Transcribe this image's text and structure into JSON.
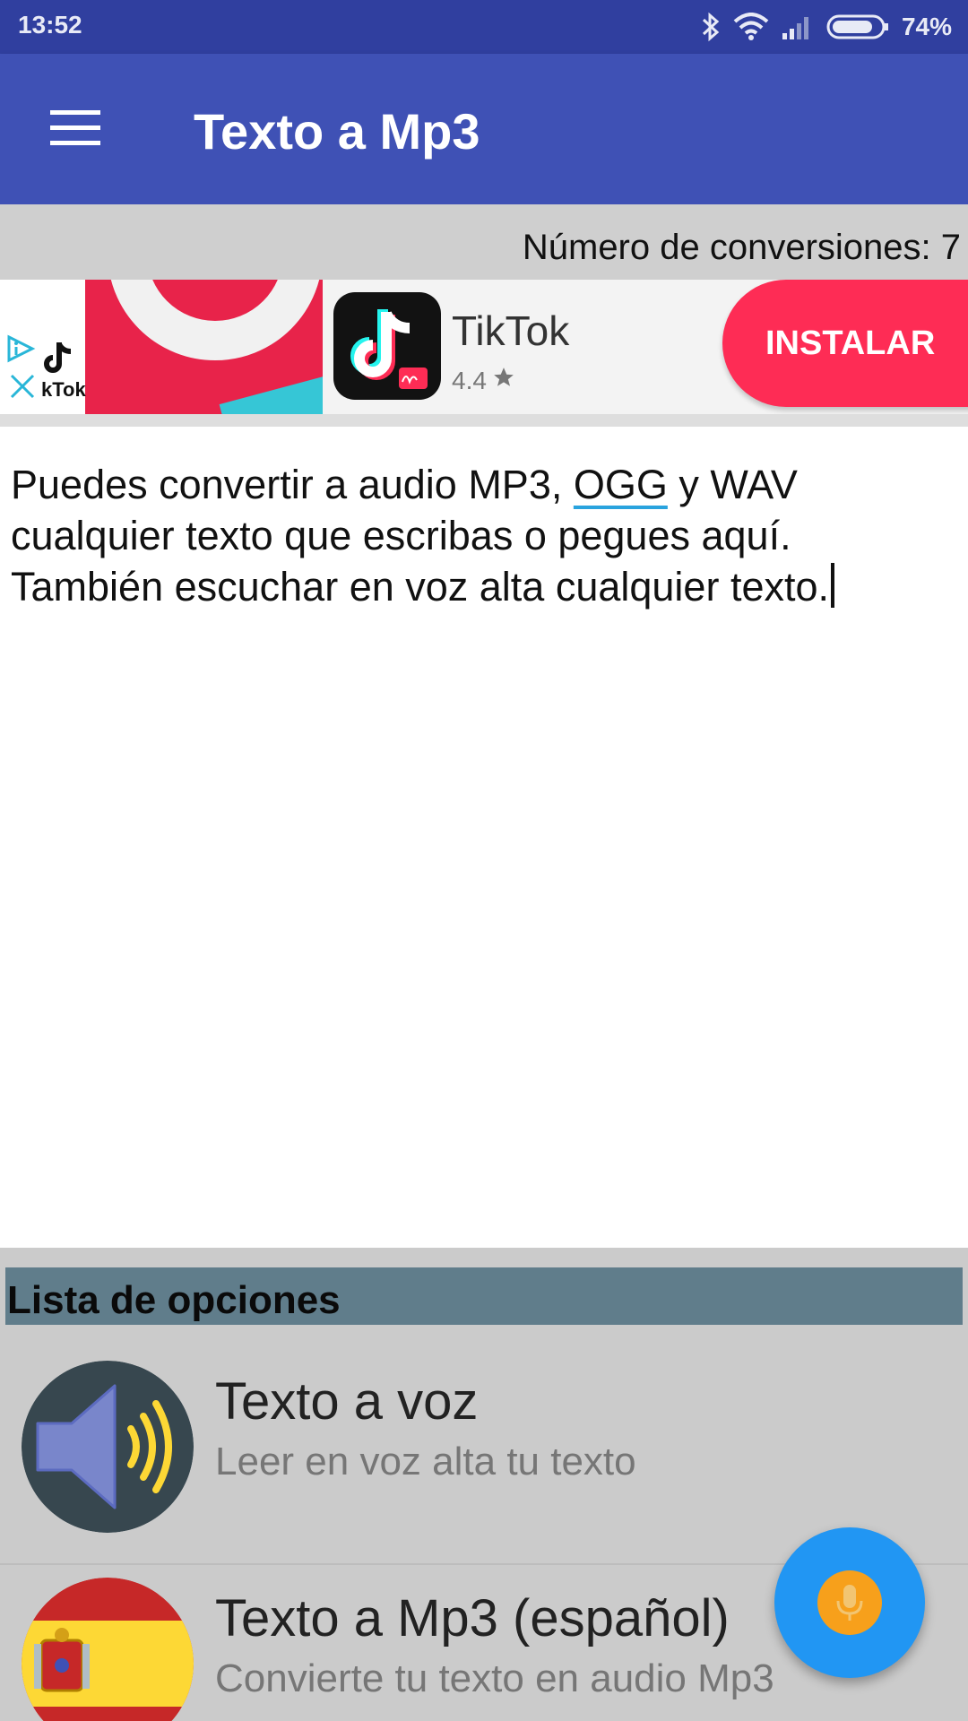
{
  "status_bar": {
    "time": "13:52",
    "battery": "74%",
    "icons": [
      "bluetooth-icon",
      "wifi-icon",
      "signal-icon",
      "battery-icon"
    ]
  },
  "app_bar": {
    "title": "Texto a Mp3",
    "menu_icon": "hamburger-menu-icon",
    "color": "#3f51b5"
  },
  "counter": {
    "label": "Número de conversiones: 7"
  },
  "ad": {
    "mini_label": "kTok",
    "app_name": "TikTok",
    "rating": "4.4",
    "rating_icon": "star-icon",
    "install_label": "INSTALAR",
    "install_color": "#fe2c55"
  },
  "editor": {
    "text_part1": "Puedes convertir a audio MP3, ",
    "text_underlined": "OGG",
    "text_part2": " y WAV\ncualquier texto que escribas o pegues aquí.\nTambién escuchar en voz alta cualquier texto."
  },
  "options": {
    "header": "Lista de opciones",
    "items": [
      {
        "title": "Texto a voz",
        "subtitle": "Leer en voz alta tu texto",
        "icon": "speaker-icon"
      },
      {
        "title": "Texto a Mp3 (español)",
        "subtitle": "Convierte tu texto en audio Mp3",
        "icon": "spain-flag-icon"
      }
    ]
  },
  "fab": {
    "icon": "microphone-icon",
    "color": "#2196f3"
  }
}
